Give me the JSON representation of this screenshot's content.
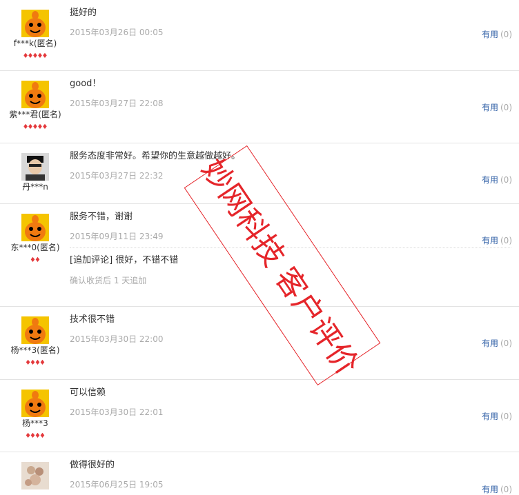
{
  "reviews": [
    {
      "text": "挺好的",
      "date": "2015年03月26日 00:05",
      "user": "f***k(匿名)",
      "avatar": "orange-mascot",
      "rating": 5,
      "useful_label": "有用",
      "useful_count": "(0)"
    },
    {
      "text": "good！",
      "date": "2015年03月27日 22:08",
      "user": "紫***君(匿名)",
      "avatar": "orange-mascot",
      "rating": 5,
      "useful_label": "有用",
      "useful_count": "(0)"
    },
    {
      "text": "服务态度非常好。希望你的生意越做越好。",
      "date": "2015年03月27日 22:32",
      "user": "丹***n",
      "avatar": "photo",
      "rating": 0,
      "useful_label": "有用",
      "useful_count": "(0)"
    },
    {
      "text": "服务不错，谢谢",
      "date": "2015年09月11日 23:49",
      "user": "东***0(匿名)",
      "avatar": "orange-mascot",
      "rating": 2,
      "useful_label": "有用",
      "useful_count": "(0)",
      "append_text": "[追加评论] 很好，不错不错",
      "append_note": "确认收货后 1 天追加"
    },
    {
      "text": "技术很不错",
      "date": "2015年03月30日 22:00",
      "user": "杨***3(匿名)",
      "avatar": "orange-mascot",
      "rating": 4,
      "useful_label": "有用",
      "useful_count": "(0)"
    },
    {
      "text": "可以信赖",
      "date": "2015年03月30日 22:01",
      "user": "杨***3",
      "avatar": "orange-mascot",
      "rating": 4,
      "useful_label": "有用",
      "useful_count": "(0)"
    },
    {
      "text": "做得很好的",
      "date": "2015年06月25日 19:05",
      "user": "",
      "avatar": "photo-food",
      "rating": 0,
      "useful_label": "有用",
      "useful_count": "(0)"
    }
  ],
  "stamp": {
    "text": "妙网科技 客户评价"
  },
  "colors": {
    "link": "#2f5fa6",
    "muted": "#aaaaaa",
    "stamp": "#e5252a",
    "rating": "#e4393c",
    "avatar_bg": "#f5b400"
  }
}
